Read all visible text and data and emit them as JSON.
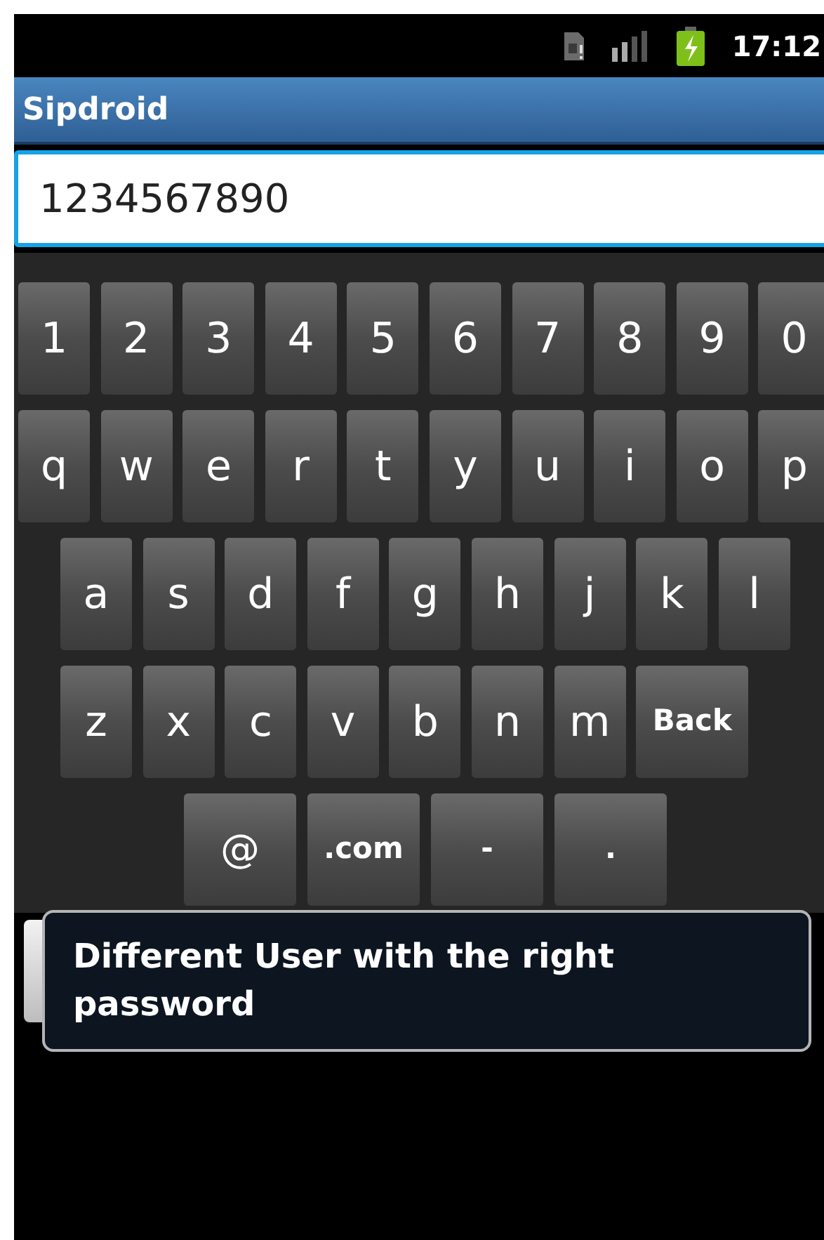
{
  "status_bar": {
    "time": "17:12"
  },
  "title_bar": {
    "title": "Sipdroid"
  },
  "number_field": {
    "value": "1234567890"
  },
  "keyboard": {
    "rows": [
      {
        "keys": [
          {
            "label": "1",
            "kind": "char"
          },
          {
            "label": "2",
            "kind": "char"
          },
          {
            "label": "3",
            "kind": "char"
          },
          {
            "label": "4",
            "kind": "char"
          },
          {
            "label": "5",
            "kind": "char"
          },
          {
            "label": "6",
            "kind": "char"
          },
          {
            "label": "7",
            "kind": "char"
          },
          {
            "label": "8",
            "kind": "char"
          },
          {
            "label": "9",
            "kind": "char"
          },
          {
            "label": "0",
            "kind": "char"
          }
        ]
      },
      {
        "keys": [
          {
            "label": "q",
            "kind": "char"
          },
          {
            "label": "w",
            "kind": "char"
          },
          {
            "label": "e",
            "kind": "char"
          },
          {
            "label": "r",
            "kind": "char"
          },
          {
            "label": "t",
            "kind": "char"
          },
          {
            "label": "y",
            "kind": "char"
          },
          {
            "label": "u",
            "kind": "char"
          },
          {
            "label": "i",
            "kind": "char"
          },
          {
            "label": "o",
            "kind": "char"
          },
          {
            "label": "p",
            "kind": "char"
          }
        ]
      },
      {
        "keys": [
          {
            "label": "a",
            "kind": "char"
          },
          {
            "label": "s",
            "kind": "char"
          },
          {
            "label": "d",
            "kind": "char"
          },
          {
            "label": "f",
            "kind": "char"
          },
          {
            "label": "g",
            "kind": "char"
          },
          {
            "label": "h",
            "kind": "char"
          },
          {
            "label": "j",
            "kind": "char"
          },
          {
            "label": "k",
            "kind": "char"
          },
          {
            "label": "l",
            "kind": "char"
          }
        ]
      },
      {
        "keys": [
          {
            "label": "z",
            "kind": "char"
          },
          {
            "label": "x",
            "kind": "char"
          },
          {
            "label": "c",
            "kind": "char"
          },
          {
            "label": "v",
            "kind": "char"
          },
          {
            "label": "b",
            "kind": "char"
          },
          {
            "label": "n",
            "kind": "char"
          },
          {
            "label": "m",
            "kind": "char"
          },
          {
            "label": "Back",
            "kind": "action"
          }
        ]
      },
      {
        "keys": [
          {
            "label": "@",
            "kind": "wide"
          },
          {
            "label": ".com",
            "kind": "action"
          },
          {
            "label": "-",
            "kind": "action"
          },
          {
            "label": ".",
            "kind": "action"
          }
        ]
      }
    ]
  },
  "toast": {
    "message": "Different User with the right password"
  }
}
